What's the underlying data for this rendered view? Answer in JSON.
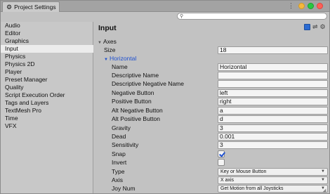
{
  "window": {
    "tab_title": "Project Settings",
    "menu_glyph": "⋮"
  },
  "search": {
    "placeholder": ""
  },
  "sidebar": {
    "items": [
      {
        "label": "Audio"
      },
      {
        "label": "Editor"
      },
      {
        "label": "Graphics"
      },
      {
        "label": "Input",
        "selected": true
      },
      {
        "label": "Physics"
      },
      {
        "label": "Physics 2D"
      },
      {
        "label": "Player"
      },
      {
        "label": "Preset Manager"
      },
      {
        "label": "Quality"
      },
      {
        "label": "Script Execution Order"
      },
      {
        "label": "Tags and Layers"
      },
      {
        "label": "TextMesh Pro"
      },
      {
        "label": "Time"
      },
      {
        "label": "VFX"
      }
    ]
  },
  "main": {
    "title": "Input",
    "axes_label": "Axes",
    "size_label": "Size",
    "size_value": "18",
    "horizontal_label": "Horizontal",
    "fields": {
      "name": {
        "label": "Name",
        "value": "Horizontal"
      },
      "descriptive_name": {
        "label": "Descriptive Name",
        "value": ""
      },
      "descriptive_negative_name": {
        "label": "Descriptive Negative Name",
        "value": ""
      },
      "negative_button": {
        "label": "Negative Button",
        "value": "left"
      },
      "positive_button": {
        "label": "Positive Button",
        "value": "right"
      },
      "alt_negative_button": {
        "label": "Alt Negative Button",
        "value": "a"
      },
      "alt_positive_button": {
        "label": "Alt Positive Button",
        "value": "d"
      },
      "gravity": {
        "label": "Gravity",
        "value": "3"
      },
      "dead": {
        "label": "Dead",
        "value": "0.001"
      },
      "sensitivity": {
        "label": "Sensitivity",
        "value": "3"
      },
      "snap": {
        "label": "Snap",
        "checked": true
      },
      "invert": {
        "label": "Invert",
        "checked": false
      },
      "type": {
        "label": "Type",
        "value": "Key or Mouse Button"
      },
      "axis": {
        "label": "Axis",
        "value": "X axis"
      },
      "joy_num": {
        "label": "Joy Num",
        "value": "Get Motion from all Joysticks"
      }
    }
  },
  "colors": {
    "selected_item": "#ececec",
    "foldout_blue": "#1d4fd0",
    "traffic_yellow": "#f6b73c",
    "traffic_green": "#28c840",
    "traffic_red": "#ff5f57"
  },
  "icons": [
    "settings-gear-icon",
    "menu-dots-icon",
    "search-icon",
    "help-book-icon",
    "presets-sliders-icon",
    "settings-gear-icon",
    "foldout-triangle-icon"
  ]
}
